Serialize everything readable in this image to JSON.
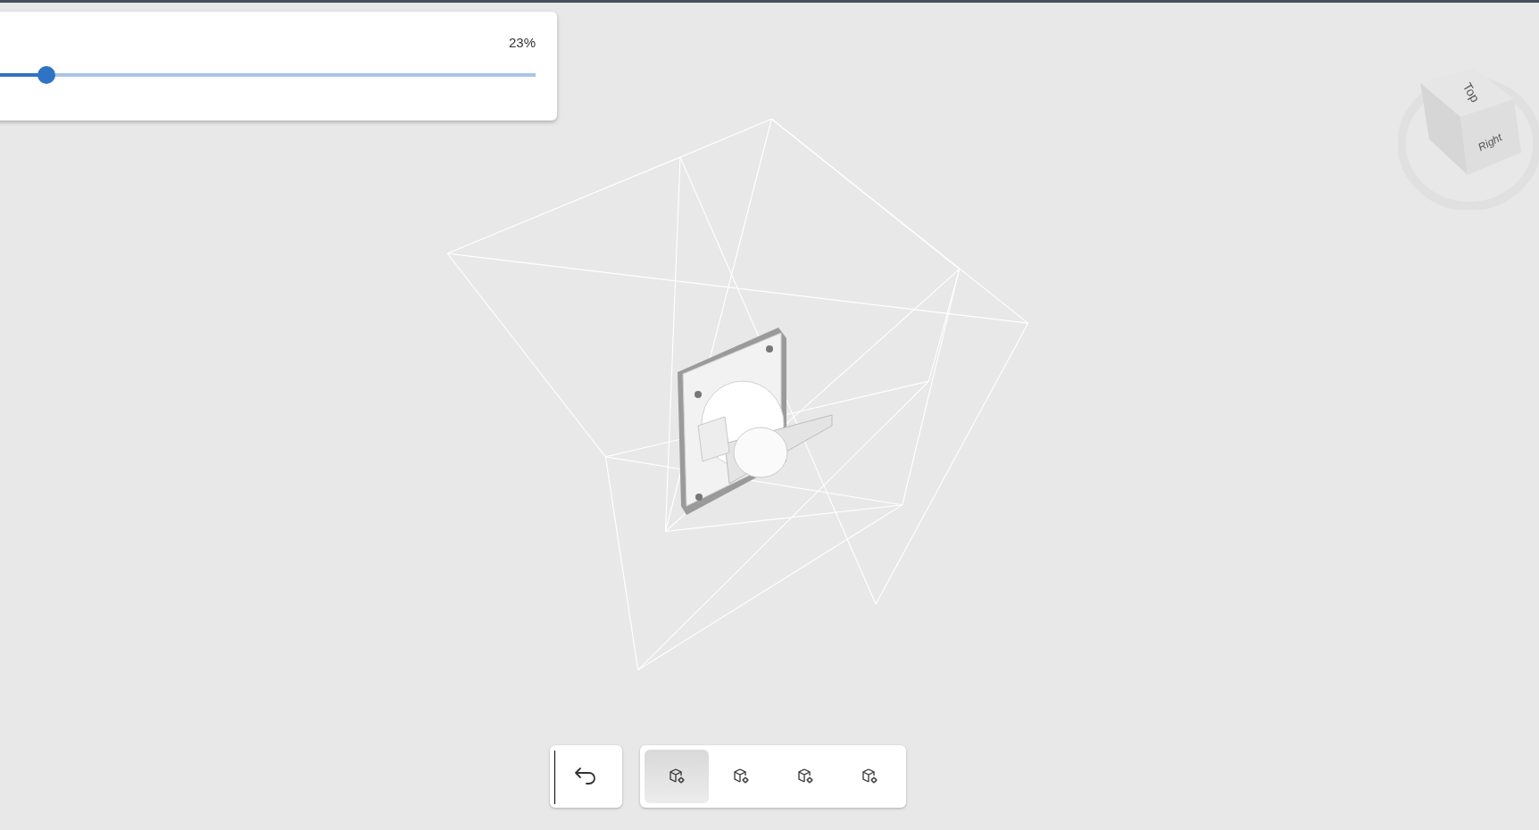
{
  "slider_panel": {
    "reading": "23%",
    "level": 0.23
  },
  "view_cube": {
    "faces": [
      "Top",
      "Right"
    ]
  },
  "toolbar": {
    "views": [
      {
        "selected": true
      },
      {
        "selected": false
      },
      {
        "selected": false
      },
      {
        "selected": false
      }
    ]
  }
}
